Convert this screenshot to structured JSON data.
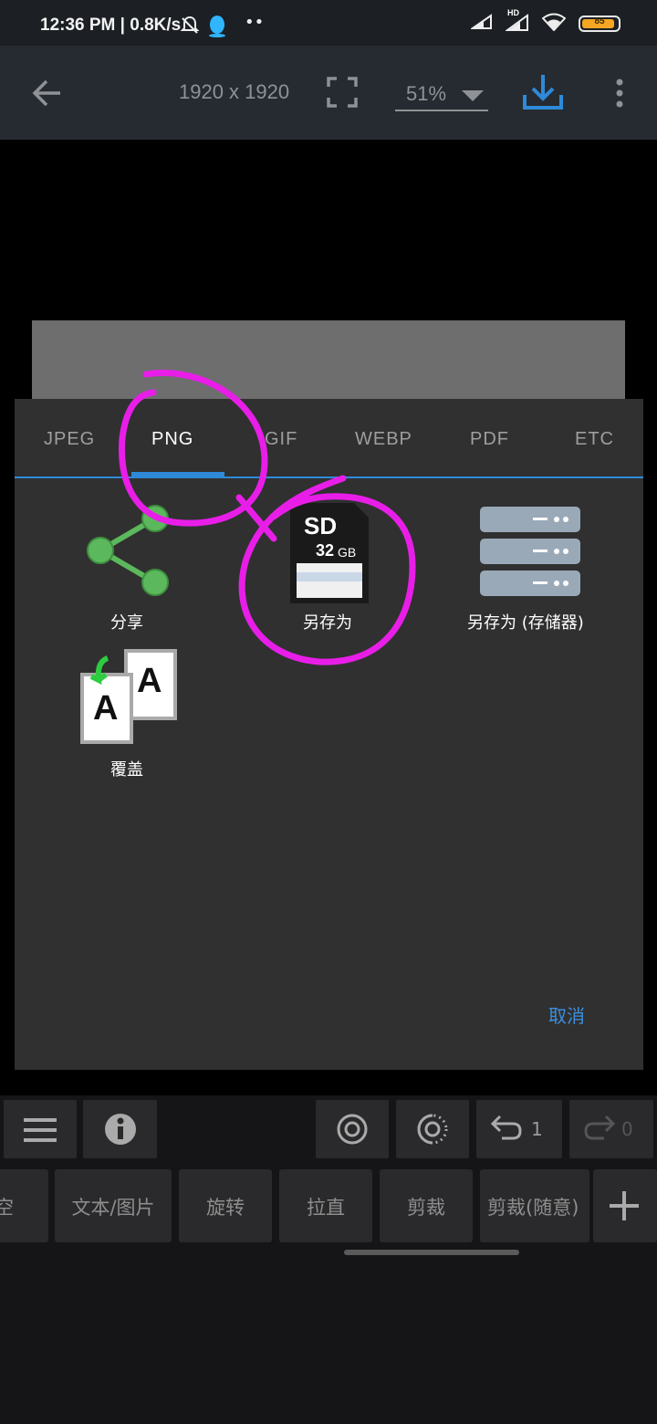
{
  "status_bar": {
    "time": "12:36 PM | 0.8K/s",
    "battery": "85",
    "hd_label": "HD",
    "dots": "••"
  },
  "toolbar": {
    "dimensions": "1920 x 1920",
    "zoom": "51%"
  },
  "dialog": {
    "tabs": [
      {
        "label": "JPEG"
      },
      {
        "label": "PNG",
        "active": true
      },
      {
        "label": "GIF"
      },
      {
        "label": "WEBP"
      },
      {
        "label": "PDF"
      },
      {
        "label": "ETC"
      }
    ],
    "options": {
      "share": "分享",
      "save_as": "另存为",
      "save_as_storage": "另存为 (存储器)",
      "overwrite": "覆盖"
    },
    "sd_card": {
      "title": "SD",
      "capacity": "32",
      "unit": "GB"
    },
    "overwrite_letter": "A",
    "cancel": "取消"
  },
  "history": {
    "undo_count": "1",
    "redo_count": "0"
  },
  "tools": [
    {
      "label": "空"
    },
    {
      "label": "文本/图片"
    },
    {
      "label": "旋转"
    },
    {
      "label": "拉直"
    },
    {
      "label": "剪裁"
    },
    {
      "label": "剪裁(随意)"
    }
  ],
  "colors": {
    "accent": "#2e8ad8",
    "annotation": "#e81ee8",
    "share_green": "#5cb85c",
    "battery": "#f5a623"
  }
}
